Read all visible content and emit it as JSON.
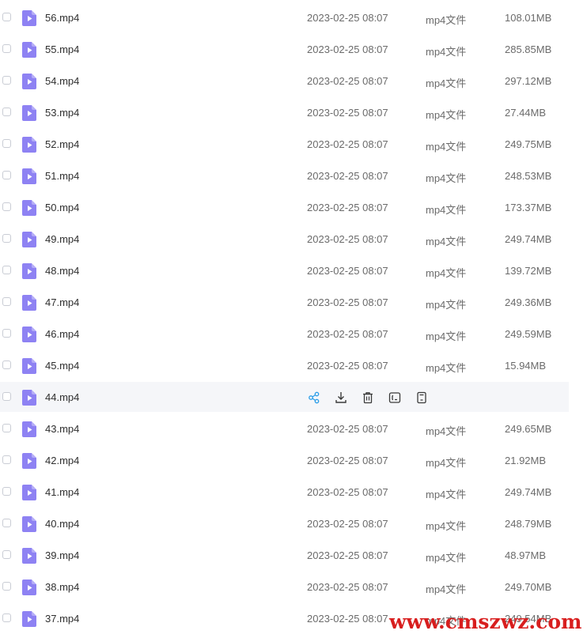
{
  "files": [
    {
      "name": "56.mp4",
      "date": "2023-02-25 08:07",
      "type": "mp4文件",
      "size": "108.01MB"
    },
    {
      "name": "55.mp4",
      "date": "2023-02-25 08:07",
      "type": "mp4文件",
      "size": "285.85MB"
    },
    {
      "name": "54.mp4",
      "date": "2023-02-25 08:07",
      "type": "mp4文件",
      "size": "297.12MB"
    },
    {
      "name": "53.mp4",
      "date": "2023-02-25 08:07",
      "type": "mp4文件",
      "size": "27.44MB"
    },
    {
      "name": "52.mp4",
      "date": "2023-02-25 08:07",
      "type": "mp4文件",
      "size": "249.75MB"
    },
    {
      "name": "51.mp4",
      "date": "2023-02-25 08:07",
      "type": "mp4文件",
      "size": "248.53MB"
    },
    {
      "name": "50.mp4",
      "date": "2023-02-25 08:07",
      "type": "mp4文件",
      "size": "173.37MB"
    },
    {
      "name": "49.mp4",
      "date": "2023-02-25 08:07",
      "type": "mp4文件",
      "size": "249.74MB"
    },
    {
      "name": "48.mp4",
      "date": "2023-02-25 08:07",
      "type": "mp4文件",
      "size": "139.72MB"
    },
    {
      "name": "47.mp4",
      "date": "2023-02-25 08:07",
      "type": "mp4文件",
      "size": "249.36MB"
    },
    {
      "name": "46.mp4",
      "date": "2023-02-25 08:07",
      "type": "mp4文件",
      "size": "249.59MB"
    },
    {
      "name": "45.mp4",
      "date": "2023-02-25 08:07",
      "type": "mp4文件",
      "size": "15.94MB"
    },
    {
      "name": "44.mp4",
      "hovered": true,
      "actions": [
        "share-icon",
        "download-icon",
        "delete-icon",
        "rename-icon",
        "more-icon"
      ]
    },
    {
      "name": "43.mp4",
      "date": "2023-02-25 08:07",
      "type": "mp4文件",
      "size": "249.65MB"
    },
    {
      "name": "42.mp4",
      "date": "2023-02-25 08:07",
      "type": "mp4文件",
      "size": "21.92MB"
    },
    {
      "name": "41.mp4",
      "date": "2023-02-25 08:07",
      "type": "mp4文件",
      "size": "249.74MB"
    },
    {
      "name": "40.mp4",
      "date": "2023-02-25 08:07",
      "type": "mp4文件",
      "size": "248.79MB"
    },
    {
      "name": "39.mp4",
      "date": "2023-02-25 08:07",
      "type": "mp4文件",
      "size": "48.97MB"
    },
    {
      "name": "38.mp4",
      "date": "2023-02-25 08:07",
      "type": "mp4文件",
      "size": "249.70MB"
    },
    {
      "name": "37.mp4",
      "date": "2023-02-25 08:07",
      "type": "mp4文件",
      "size": "249.54MB"
    }
  ],
  "colors": {
    "file_icon": "#8e82f3",
    "share_icon": "#2b9de8",
    "action_icon": "#3a3a3a",
    "hover_bg": "#f5f6f9",
    "watermark": "#d81e1e"
  },
  "watermark": "www.cmszwz.com"
}
